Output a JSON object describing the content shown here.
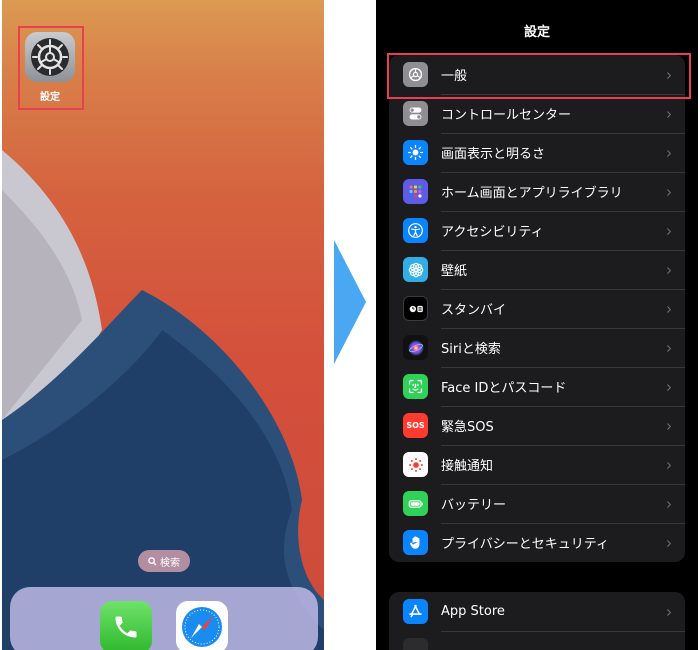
{
  "home": {
    "settings_app_label": "設定",
    "search_label": "検索"
  },
  "settings": {
    "title": "設定",
    "group1": [
      {
        "label": "一般",
        "icon": "gear-icon",
        "color": "#8e8e93"
      },
      {
        "label": "コントロールセンター",
        "icon": "toggles-icon",
        "color": "#8e8e93"
      },
      {
        "label": "画面表示と明るさ",
        "icon": "sun-icon",
        "color": "#0a84ff"
      },
      {
        "label": "ホーム画面とアプリライブラリ",
        "icon": "app-grid-icon",
        "color": "#5e5ce6"
      },
      {
        "label": "アクセシビリティ",
        "icon": "accessibility-icon",
        "color": "#0a84ff"
      },
      {
        "label": "壁紙",
        "icon": "flower-icon",
        "color": "#32ade6"
      },
      {
        "label": "スタンバイ",
        "icon": "standby-icon",
        "color": "#000000"
      },
      {
        "label": "Siriと検索",
        "icon": "siri-icon",
        "color": "#111111"
      },
      {
        "label": "Face IDとパスコード",
        "icon": "face-id-icon",
        "color": "#30d158"
      },
      {
        "label": "緊急SOS",
        "icon": "sos-icon",
        "color": "#ff3b30"
      },
      {
        "label": "接触通知",
        "icon": "exposure-icon",
        "color": "#ffffff"
      },
      {
        "label": "バッテリー",
        "icon": "battery-icon",
        "color": "#30d158"
      },
      {
        "label": "プライバシーとセキュリティ",
        "icon": "hand-icon",
        "color": "#0a84ff"
      }
    ],
    "group2": [
      {
        "label": "App Store",
        "icon": "app-store-icon",
        "color": "#0a84ff"
      }
    ],
    "sos_text": "SOS",
    "chevron": "›"
  },
  "colors": {
    "highlight": "#e8404f",
    "arrow": "#4aa8f2"
  }
}
